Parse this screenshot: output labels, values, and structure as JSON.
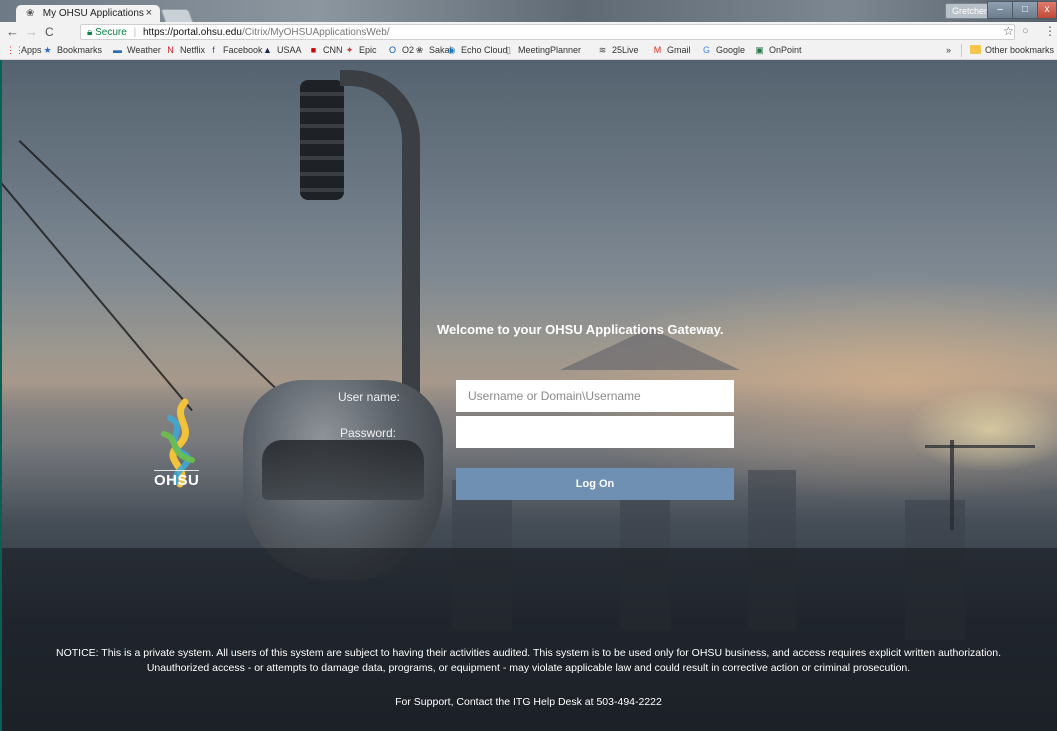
{
  "browser": {
    "tab_title": "My OHSU Applications",
    "tab_close": "×",
    "profile": "Gretchen",
    "secure_label": "Secure",
    "url_host": "https://portal.ohsu.edu",
    "url_path": "/Citrix/MyOHSUApplicationsWeb/",
    "window_buttons": {
      "minimize": "–",
      "maximize": "□",
      "close": "x"
    }
  },
  "bookmarks": [
    {
      "label": "Apps",
      "icon": "apps-grid-icon"
    },
    {
      "label": "Bookmarks",
      "icon": "star-icon"
    },
    {
      "label": "Weather",
      "icon": "weather-icon"
    },
    {
      "label": "Netflix",
      "icon": "netflix-icon"
    },
    {
      "label": "Facebook",
      "icon": "facebook-icon"
    },
    {
      "label": "USAA",
      "icon": "usaa-icon"
    },
    {
      "label": "CNN",
      "icon": "cnn-icon"
    },
    {
      "label": "Epic",
      "icon": "epic-icon"
    },
    {
      "label": "O2",
      "icon": "outlook-icon"
    },
    {
      "label": "Sakai",
      "icon": "sakai-icon"
    },
    {
      "label": "Echo Cloud",
      "icon": "echo-icon"
    },
    {
      "label": "MeetingPlanner",
      "icon": "page-icon"
    },
    {
      "label": "25Live",
      "icon": "25live-icon"
    },
    {
      "label": "Gmail",
      "icon": "gmail-icon"
    },
    {
      "label": "Google",
      "icon": "google-icon"
    },
    {
      "label": "OnPoint",
      "icon": "onpoint-icon"
    }
  ],
  "bookmarks_overflow": "»",
  "other_bookmarks": "Other bookmarks",
  "login": {
    "welcome": "Welcome to your OHSU Applications Gateway.",
    "username_label": "User name:",
    "username_placeholder": "Username or Domain\\Username",
    "password_label": "Password:",
    "logon_label": "Log On"
  },
  "logo_text": "OHSU",
  "notice_line1": "NOTICE: This is a private system. All users of this system are subject to having their activities audited. This system is to be used only for OHSU business, and access requires explicit written authorization.",
  "notice_line2": "Unauthorized access - or attempts to damage data, programs, or equipment - may violate applicable law and could result in corrective action or criminal prosecution.",
  "support": "For Support, Contact the ITG Help Desk at 503-494-2222",
  "colors": {
    "logon_button": "#6f8fb3",
    "secure_green": "#0b8043"
  }
}
